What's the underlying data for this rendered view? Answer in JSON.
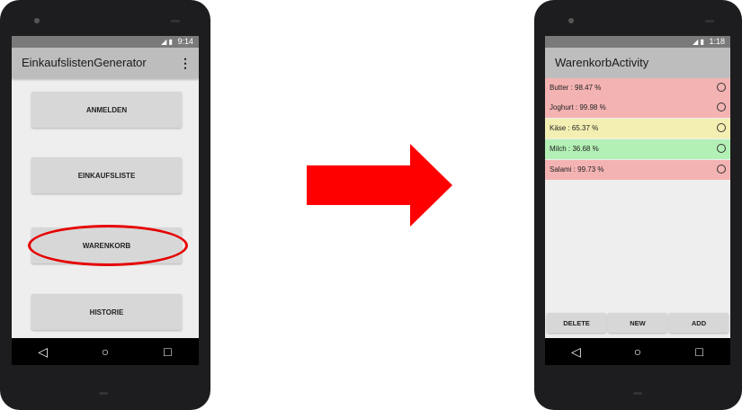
{
  "left_phone": {
    "status_time": "9:14",
    "app_title": "EinkaufslistenGenerator",
    "overflow_icon": "more-vert-icon",
    "buttons": [
      "ANMELDEN",
      "EINKAUFSLISTE",
      "WARENKORB",
      "HISTORIE"
    ],
    "highlighted_button": "WARENKORB",
    "highlight_color": "#e60000"
  },
  "arrow": {
    "color": "#ff0000",
    "icon": "right-arrow-icon"
  },
  "right_phone": {
    "status_time": "1:18",
    "app_title": "WarenkorbActivity",
    "items": [
      {
        "label": "Butter : 98.47 %",
        "color": "#f4b3b3"
      },
      {
        "label": "Joghurt : 99.98 %",
        "color": "#f4b3b3"
      },
      {
        "label": "Käse : 65.37 %",
        "color": "#f3efb3"
      },
      {
        "label": "Milch : 36.68 %",
        "color": "#b3f0b5"
      },
      {
        "label": "Salami : 99.73 %",
        "color": "#f4b3b3"
      }
    ],
    "bottom_buttons": [
      "DELETE",
      "NEW",
      "ADD"
    ]
  },
  "navbar": {
    "back_icon": "◁",
    "home_icon": "○",
    "recents_icon": "□"
  }
}
